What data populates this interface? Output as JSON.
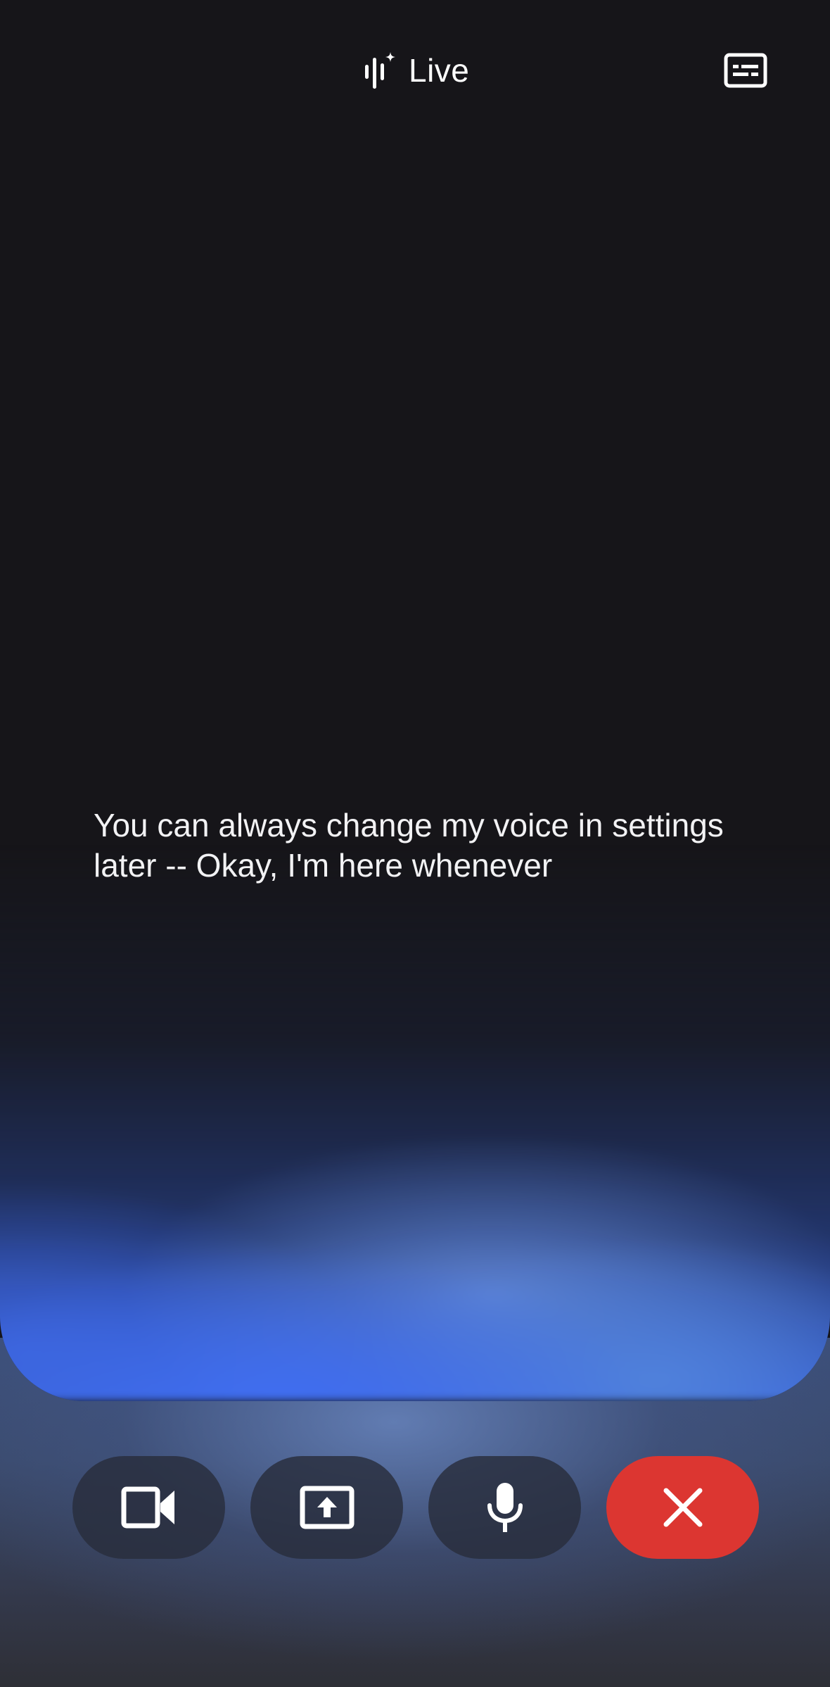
{
  "header": {
    "title": "Live",
    "title_icon": "live-sparkle-waveform-icon",
    "captions_icon": "closed-captions-icon"
  },
  "transcript": {
    "text": "You can always change my voice in settings later -- Okay, I'm here whenever"
  },
  "controls": [
    {
      "name": "camera",
      "icon": "video-camera-icon"
    },
    {
      "name": "share-screen",
      "icon": "screen-share-icon"
    },
    {
      "name": "microphone",
      "icon": "microphone-icon"
    },
    {
      "name": "end",
      "icon": "close-icon"
    }
  ],
  "colors": {
    "background": "#161519",
    "end_button": "#dc3631",
    "control_button": "#2b3143",
    "glow_blue": "#3f6ff0",
    "text": "#ffffff"
  }
}
